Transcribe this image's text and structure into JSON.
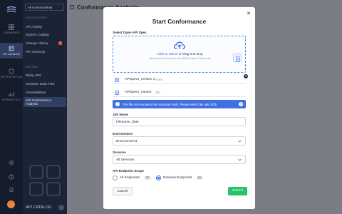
{
  "rail": {
    "items": [
      {
        "label": "DASHBOARD"
      },
      {
        "label": "API CATALOG"
      },
      {
        "label": "API PROTECTION"
      },
      {
        "label": "API ANALYTICS"
      }
    ]
  },
  "sidebar": {
    "environment": "All Environments",
    "section_discovery": "API DISCOVERY",
    "discovery_items": [
      "API Activity",
      "Explore Catalog",
      "Change History",
      "API Journeys"
    ],
    "change_badge": "1",
    "section_risk": "API RISK",
    "risk_items": [
      "Risky APIs",
      "Sensitive Data Flow",
      "Vulnerabilities",
      "API Conformance Analysis"
    ],
    "footer": "API CATALOG"
  },
  "page": {
    "title": "Conformance Analysis"
  },
  "modal": {
    "title": "Start Conformance",
    "close_icon": "close-icon",
    "spec_label": "Select Open API Spec",
    "drop_link": "Click to Select",
    "drop_text": " or drag and drop",
    "drop_hint": "yaml or json files (max size 5GB & upto 3 files) only",
    "files": [
      {
        "name": "APIspecs_version 1",
        "size": "80KB"
      },
      {
        "name": "APIspecs_name2",
        "size": "0kb"
      }
    ],
    "alert": "The file size exceeds the maximum limit. Please select file upto 5Gb",
    "job_label": "Job Name",
    "job_value": "Filename_date",
    "env_label": "Environment",
    "env_value": "Environment1",
    "services_label": "Services",
    "services_value": "All Services",
    "scope_label": "API Endpoint Scope",
    "scope_all": "All Endpoints",
    "scope_all_count": "200",
    "scope_ext": "External Endpoints",
    "scope_ext_count": "200",
    "cancel": "Cancel",
    "submit": "Submit",
    "colors": {
      "accent": "#2e6be6",
      "submit": "#27c26c",
      "alert": "#3f6fe0"
    }
  }
}
